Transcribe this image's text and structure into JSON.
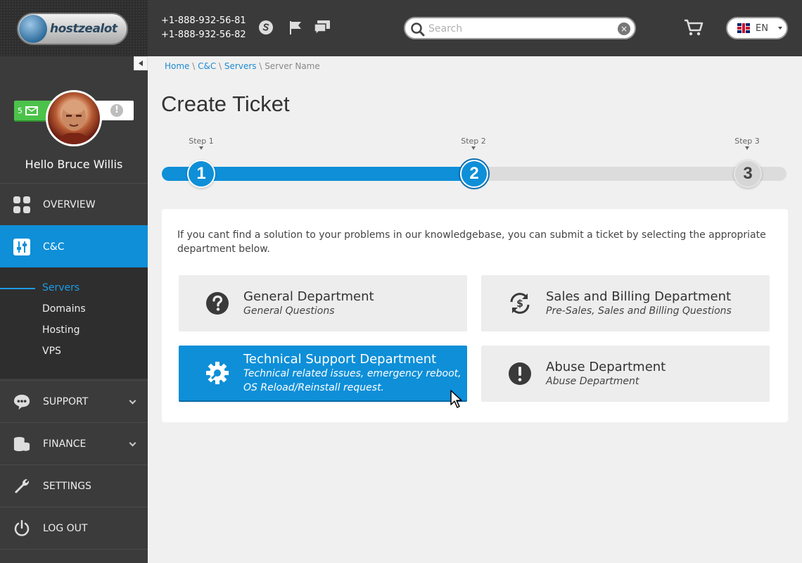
{
  "brand": {
    "logo_text": "hostzealot"
  },
  "header": {
    "phone1": "+1-888-932-56-81",
    "phone2": "+1-888-932-56-82",
    "search_placeholder": "Search",
    "clear_symbol": "×",
    "language": "EN",
    "icons": [
      "skype-icon",
      "flag-icon",
      "chat-icon",
      "magnifier-icon",
      "cart-icon",
      "uk-flag-icon"
    ]
  },
  "profile": {
    "mail_count": "5",
    "alert_symbol": "!",
    "hello_prefix": "Hello ",
    "user_name": "Bruce Willis"
  },
  "sidebar": {
    "items": [
      {
        "label": "OVERVIEW",
        "icon": "grid-icon"
      },
      {
        "label": "C&C",
        "icon": "sliders-icon"
      },
      {
        "label": "SUPPORT",
        "icon": "speech-bubble-icon"
      },
      {
        "label": "FINANCE",
        "icon": "coins-icon"
      },
      {
        "label": "SETTINGS",
        "icon": "wrench-icon"
      },
      {
        "label": "LOG OUT",
        "icon": "power-icon"
      }
    ],
    "subitems": [
      "Servers",
      "Domains",
      "Hosting",
      "VPS"
    ]
  },
  "breadcrumb": {
    "home": "Home",
    "cc": "C&C",
    "servers": "Servers",
    "current": "Server Name",
    "sep": " \\ "
  },
  "page": {
    "title": "Create Ticket"
  },
  "steps": {
    "current_step": 2,
    "total_steps": 3,
    "items": [
      {
        "label": "Step 1",
        "number": "1"
      },
      {
        "label": "Step 2",
        "number": "2"
      },
      {
        "label": "Step 3",
        "number": "3"
      }
    ]
  },
  "panel": {
    "intro": "If you cant find a solution to your problems in our knowledgebase, you can submit a ticket by selecting the appropriate department below.",
    "departments": [
      {
        "title": "General Department",
        "subtitle": "General Questions",
        "icon": "question-icon"
      },
      {
        "title": "Sales and Billing Department",
        "subtitle": "Pre-Sales, Sales and Billing Questions",
        "icon": "dollar-refresh-icon"
      },
      {
        "title": "Technical Support Department",
        "subtitle": "Technical related issues, emergency reboot, OS Reload/Reinstall request.",
        "icon": "gear-icon",
        "selected": true
      },
      {
        "title": "Abuse Department",
        "subtitle": "Abuse Department",
        "icon": "exclamation-icon"
      }
    ]
  },
  "colors": {
    "accent": "#0e8fd8",
    "sidebar_bg": "#3b3b3b",
    "header_bg": "#3a3a3a",
    "mail_green": "#4cc24a"
  }
}
